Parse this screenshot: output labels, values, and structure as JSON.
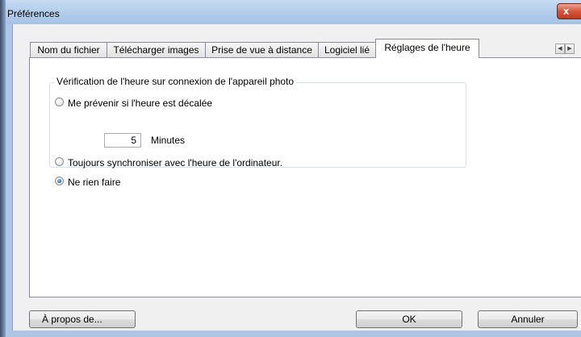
{
  "window": {
    "title": "Préférences",
    "close_label": "x"
  },
  "tabs": [
    {
      "label": "Nom du fichier"
    },
    {
      "label": "Télécharger images"
    },
    {
      "label": "Prise de vue à distance"
    },
    {
      "label": "Logiciel lié"
    },
    {
      "label": "Réglages de l'heure",
      "active": true
    }
  ],
  "tab_scroll": {
    "left": "◀",
    "right": "▶"
  },
  "group": {
    "title": "Vérification de l'heure sur connexion de l'appareil photo",
    "options": [
      {
        "label": "Me prévenir si l'heure est décalée",
        "checked": false
      },
      {
        "label": "Toujours synchroniser avec l'heure de l'ordinateur.",
        "checked": false
      },
      {
        "label": "Ne rien faire",
        "checked": true
      }
    ],
    "minutes_value": "5",
    "minutes_label": "Minutes"
  },
  "buttons": {
    "about": "À propos de...",
    "ok": "OK",
    "cancel": "Annuler"
  }
}
